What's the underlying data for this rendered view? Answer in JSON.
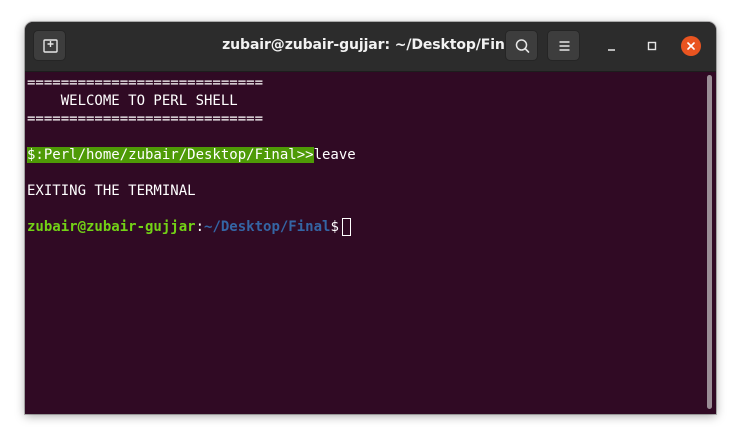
{
  "window": {
    "title": "zubair@zubair-gujjar: ~/Desktop/Final",
    "controls": {
      "new_tab_icon": "new-tab-icon",
      "search_icon": "search-icon",
      "menu_icon": "hamburger-menu-icon",
      "minimize_icon": "minimize-icon",
      "maximize_icon": "maximize-icon",
      "close_icon": "close-icon"
    }
  },
  "terminal": {
    "banner_top": "============================",
    "banner_text": "    WELCOME TO PERL SHELL",
    "banner_bottom": "============================",
    "perl_prompt": "$:Perl/home/zubair/Desktop/Final>>",
    "perl_command": "leave",
    "exit_message": "EXITING THE TERMINAL",
    "shell_user_host": "zubair@zubair-gujjar",
    "shell_sep": ":",
    "shell_path": "~/Desktop/Final",
    "shell_symbol": "$"
  },
  "colors": {
    "terminal_bg": "#300a24",
    "titlebar_bg": "#2c2c2c",
    "perl_prompt_highlight": "#4e9a06",
    "user_host": "#73d216",
    "path": "#3465a4",
    "close_button": "#e95420"
  }
}
